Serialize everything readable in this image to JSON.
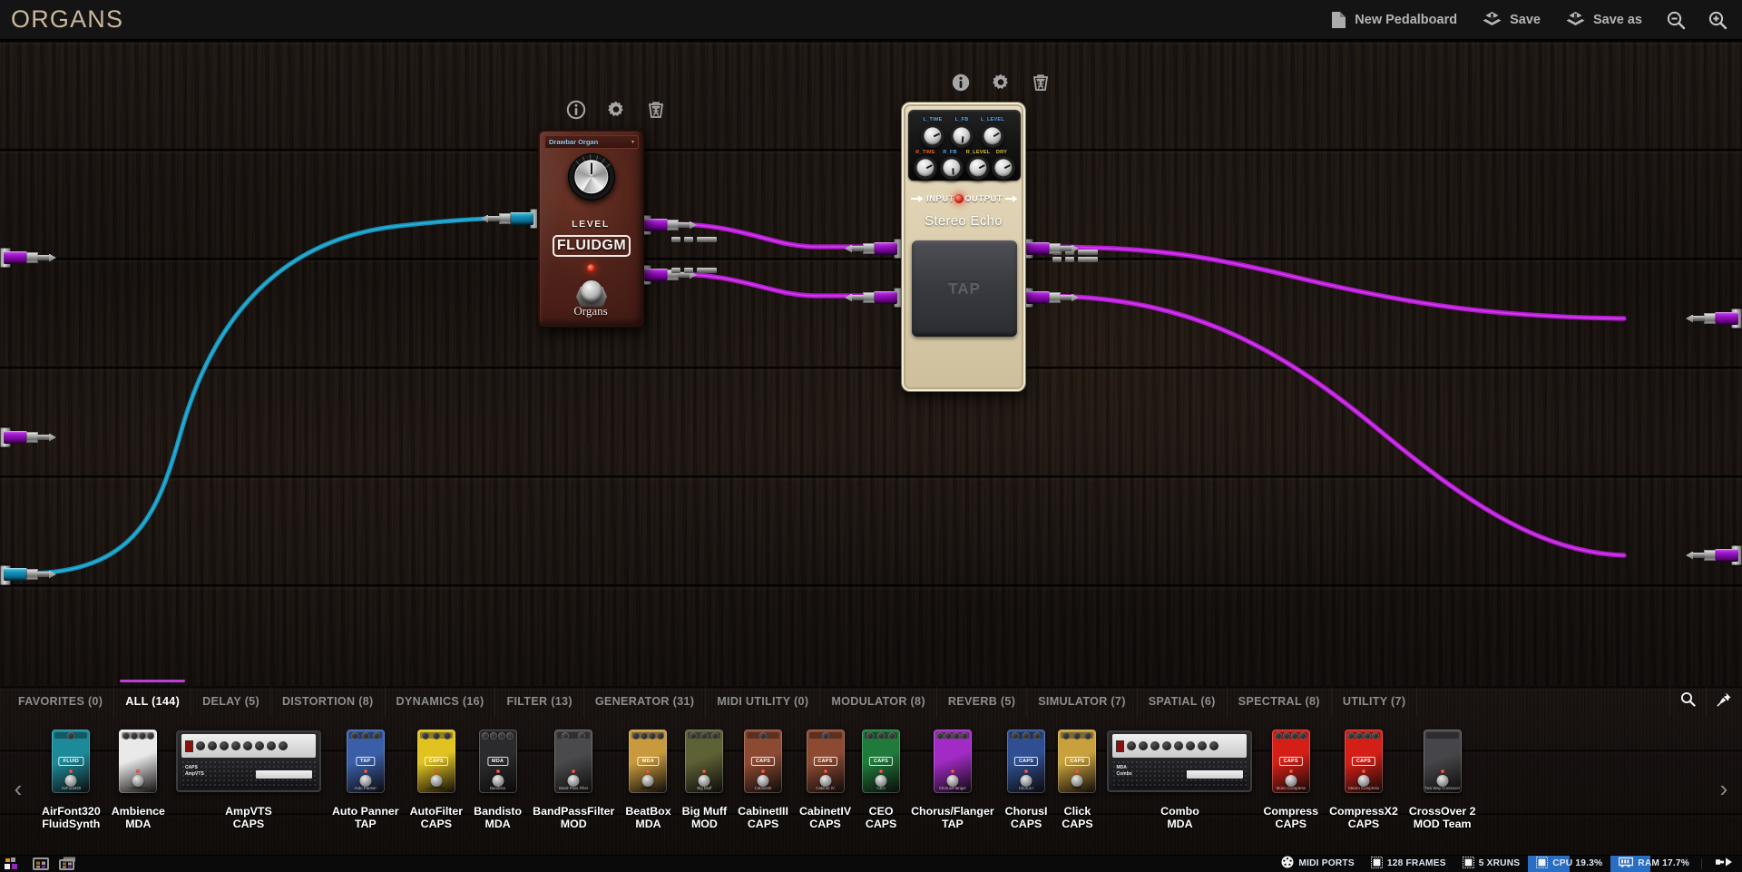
{
  "app": {
    "board_title": "ORGANS",
    "accent_purple": "#b93fd6",
    "accent_blue": "#2a6ec4",
    "cable_audio_color": "#b818d6",
    "cable_midi_color": "#1293bb"
  },
  "toolbar": {
    "new_pedalboard": "New Pedalboard",
    "save": "Save",
    "save_as": "Save as",
    "zoom_out_icon": "zoom-out-icon",
    "zoom_in_icon": "zoom-in-icon",
    "doc_icon": "document-icon",
    "save_icon": "save-icon"
  },
  "pedals": [
    {
      "id": "fluidgm",
      "tools": [
        "info-icon",
        "gear-icon",
        "trash-icon"
      ],
      "preset": "Drawbar Organ",
      "caret": "▾",
      "knob_label": "LEVEL",
      "brand": "FLUIDGM",
      "name": "Organs"
    },
    {
      "id": "stereo-echo",
      "tools": [
        "info-icon",
        "gear-icon",
        "trash-icon"
      ],
      "knobs_top": [
        "L_TIME",
        "L_FB",
        "L_LEVEL"
      ],
      "knobs_top_colors": [
        "#3f8fe0",
        "#3f8fe0",
        "#3f8fe0"
      ],
      "knobs_bottom": [
        "R_TIME",
        "R_FB",
        "R_LEVEL",
        "DRY"
      ],
      "knobs_bottom_colors": [
        "#e05a2b",
        "#3f8fe0",
        "#e0c23f",
        "#e0c23f"
      ],
      "input_label": "INPUT",
      "output_label": "OUTPUT",
      "name": "Stereo Echo",
      "footswitch_label": "TAP"
    }
  ],
  "browser": {
    "tabs": [
      {
        "label": "FAVORITES (0)",
        "active": false
      },
      {
        "label": "ALL (144)",
        "active": true
      },
      {
        "label": "DELAY (5)",
        "active": false
      },
      {
        "label": "DISTORTION (8)",
        "active": false
      },
      {
        "label": "DYNAMICS (16)",
        "active": false
      },
      {
        "label": "FILTER (13)",
        "active": false
      },
      {
        "label": "GENERATOR (31)",
        "active": false
      },
      {
        "label": "MIDI UTILITY (0)",
        "active": false
      },
      {
        "label": "MODULATOR (8)",
        "active": false
      },
      {
        "label": "REVERB (5)",
        "active": false
      },
      {
        "label": "SIMULATOR (7)",
        "active": false
      },
      {
        "label": "SPATIAL (6)",
        "active": false
      },
      {
        "label": "SPECTRAL (8)",
        "active": false
      },
      {
        "label": "UTILITY (7)",
        "active": false
      }
    ],
    "search_icon": "search-icon",
    "pin_icon": "pin-icon",
    "prev_arrow": "‹",
    "next_arrow": "›",
    "plugins": [
      {
        "name": "AirFont320",
        "brand": "FluidSynth",
        "kind": "stomp",
        "color": "#1c8a99",
        "badge": "FLUID",
        "caption": "AirFont320",
        "knobs": 1
      },
      {
        "name": "Ambience",
        "brand": "MDA",
        "kind": "stomp",
        "color": "#e9e9ea",
        "badge": "",
        "caption": "Ambience",
        "knobs": 4
      },
      {
        "name": "AmpVTS",
        "brand": "CAPS",
        "kind": "amp",
        "label1": "CAPS",
        "label2": "AmpVTS"
      },
      {
        "name": "Auto Panner",
        "brand": "TAP",
        "kind": "stomp",
        "color": "#3a5fa8",
        "badge": "TAP",
        "caption": "Auto Panner",
        "knobs": 3
      },
      {
        "name": "AutoFilter",
        "brand": "CAPS",
        "kind": "stomp",
        "color": "#e0c221",
        "badge": "CAPS",
        "caption": "Auto Filter",
        "knobs": 3
      },
      {
        "name": "Bandisto",
        "brand": "MDA",
        "kind": "stomp",
        "color": "#2b2b2d",
        "badge": "MDA",
        "caption": "Bandisto",
        "knobs": 4
      },
      {
        "name": "BandPassFilter",
        "brand": "MOD",
        "kind": "stomp",
        "color": "#4a4a4d",
        "badge": "",
        "caption": "Band Pass Filter",
        "knobs": 2
      },
      {
        "name": "BeatBox",
        "brand": "MDA",
        "kind": "stomp",
        "color": "#c89a3c",
        "badge": "MDA",
        "caption": "BeatBox",
        "knobs": 4
      },
      {
        "name": "Big Muff",
        "brand": "MOD",
        "kind": "stomp",
        "color": "#5d6135",
        "badge": "",
        "caption": "Big Muff",
        "knobs": 3
      },
      {
        "name": "CabinetIII",
        "brand": "CAPS",
        "kind": "stomp",
        "color": "#8c4a33",
        "badge": "CAPS",
        "caption": "CabinetIII",
        "knobs": 1
      },
      {
        "name": "CabinetIV",
        "brand": "CAPS",
        "kind": "stomp",
        "color": "#8c4a33",
        "badge": "CAPS",
        "caption": "Cabinet IV",
        "knobs": 1
      },
      {
        "name": "CEO",
        "brand": "CAPS",
        "kind": "stomp",
        "color": "#1f7a3c",
        "badge": "CAPS",
        "caption": "CEO",
        "knobs": 3
      },
      {
        "name": "Chorus/Flanger",
        "brand": "TAP",
        "kind": "stomp",
        "color": "#a12bc4",
        "badge": "",
        "caption": "Chorus/Flanger",
        "knobs": 4
      },
      {
        "name": "ChorusI",
        "brand": "CAPS",
        "kind": "stomp",
        "color": "#2f4f92",
        "badge": "CAPS",
        "caption": "Chorus I",
        "knobs": 3
      },
      {
        "name": "Click",
        "brand": "CAPS",
        "kind": "stomp",
        "color": "#c8a03c",
        "badge": "CAPS",
        "caption": "Click",
        "knobs": 3
      },
      {
        "name": "Combo",
        "brand": "MDA",
        "kind": "amp",
        "label1": "MDA",
        "label2": "Combo"
      },
      {
        "name": "Compress",
        "brand": "CAPS",
        "kind": "stomp",
        "color": "#d41f17",
        "badge": "CAPS",
        "caption": "Mono Compress",
        "knobs": 4
      },
      {
        "name": "CompressX2",
        "brand": "CAPS",
        "kind": "stomp",
        "color": "#d41f17",
        "badge": "CAPS",
        "caption": "Stereo Compress",
        "knobs": 4
      },
      {
        "name": "CrossOver 2",
        "brand": "MOD Team",
        "kind": "stomp",
        "color": "#46464a",
        "badge": "",
        "caption": "Two Way Crossover",
        "knobs": 0
      }
    ]
  },
  "statusbar": {
    "left_icons": [
      "mod-logo-icon",
      "pedalboards-icon",
      "banks-icon"
    ],
    "items": [
      {
        "icon": "midi-icon",
        "label": "MIDI PORTS",
        "meter": 0
      },
      {
        "icon": "frames-icon",
        "label": "128 FRAMES",
        "meter": 0
      },
      {
        "icon": "xruns-icon",
        "label": "5 XRUNS",
        "meter": 0
      },
      {
        "icon": "cpu-icon",
        "label": "CPU 19.3%",
        "meter": 19.3
      },
      {
        "icon": "ram-icon",
        "label": "RAM 17.7%",
        "meter": 17.7
      }
    ],
    "plug_icon": "plug-icon"
  }
}
